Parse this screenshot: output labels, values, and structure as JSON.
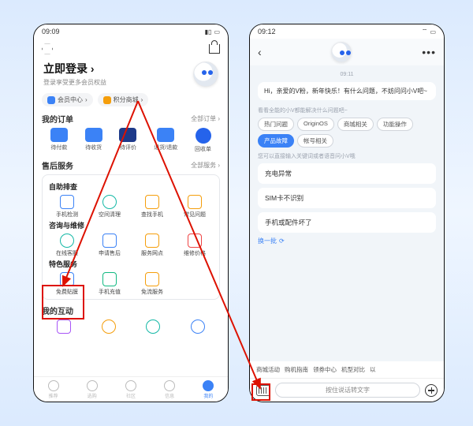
{
  "left": {
    "status": {
      "time": "09:09",
      "icons": "◉ ◎ ◎ ◉ ◉",
      "right": "▭ ◧"
    },
    "login": {
      "title": "立即登录",
      "chev": "›",
      "sub": "登录享受更多会员权益"
    },
    "chips": {
      "member": "会员中心",
      "points": "积分商城",
      "arrow": "›"
    },
    "orders": {
      "title": "我的订单",
      "more": "全部订单 ›",
      "items": [
        "待付款",
        "待收货",
        "待评价",
        "退货/退款",
        "回收单"
      ]
    },
    "after": {
      "title": "售后服务",
      "more": "全部服务 ›"
    },
    "self": {
      "title": "自助排查",
      "items": [
        "手机检测",
        "空间清理",
        "查找手机",
        "常见问题"
      ]
    },
    "consult": {
      "title": "咨询与维修",
      "items": [
        "在线客服",
        "申请售后",
        "服务网点",
        "维修价格"
      ]
    },
    "feature": {
      "title": "特色服务",
      "items": [
        "免费贴膜",
        "手机充值",
        "免流服务"
      ]
    },
    "interact": {
      "title": "我的互动"
    },
    "tabs": [
      "推荐",
      "选购",
      "社区",
      "信息",
      "我的"
    ]
  },
  "right": {
    "status": {
      "time": "09:12",
      "icons": "◉ ◎ ◎ ◉ ◉",
      "right": "☐ ◧"
    },
    "timestamp": "09:11",
    "greet": "Hi，亲爱的V粉，新年快乐！有什么问题，不妨问问小V吧~",
    "hint1": "看看全能的小V都能解决什么问题吧~",
    "cats": [
      "热门问题",
      "OriginOS",
      "商城相关",
      "功能操作",
      "产品故障",
      "帐号相关"
    ],
    "active_cat_index": 4,
    "hint2": "您可以直接输入关键词或者语音问小V哦",
    "faq": [
      "充电异常",
      "SIM卡不识别",
      "手机或配件坏了"
    ],
    "refresh": "换一批",
    "refresh_icon": "⟳",
    "bottom_chips": [
      "商城活动",
      "购机指南",
      "领券中心",
      "机型对比",
      "以"
    ],
    "voice": "按住说话转文字"
  }
}
